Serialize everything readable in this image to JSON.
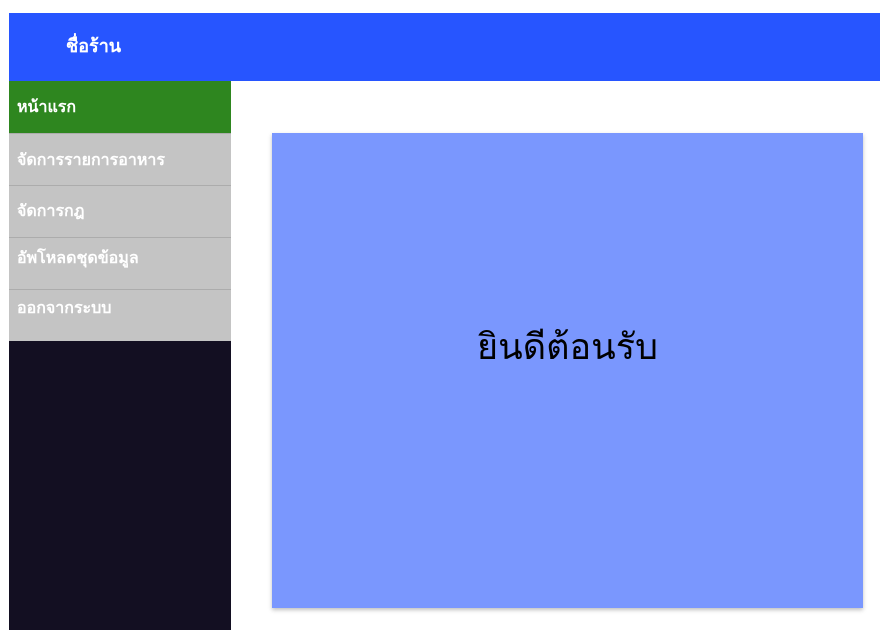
{
  "header": {
    "shop_name": "ชื่อร้าน",
    "background_color": "#2755ff"
  },
  "sidebar": {
    "background_color": "#130f22",
    "items": [
      {
        "label": "หน้าแรก",
        "active": true,
        "color": "#2e861f"
      },
      {
        "label": "จัดการรายการอาหาร",
        "active": false,
        "color": "#c4c4c4"
      },
      {
        "label": "จัดการกฎ",
        "active": false,
        "color": "#c4c4c4"
      },
      {
        "label": "อัพโหลดชุดข้อมูล",
        "active": false,
        "color": "#c4c4c4"
      },
      {
        "label": "ออกจากระบบ",
        "active": false,
        "color": "#c4c4c4"
      }
    ]
  },
  "main": {
    "welcome_text": "ยินดีต้อนรับ",
    "panel_color": "#7a97fe"
  }
}
